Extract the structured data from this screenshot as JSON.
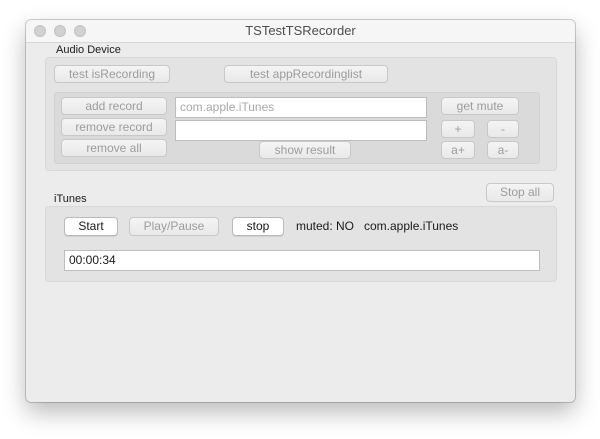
{
  "window": {
    "title": "TSTestTSRecorder"
  },
  "audio_device": {
    "label": "Audio Device",
    "test_is_recording": "test isRecording",
    "test_app_recording_list": "test appRecordinglist",
    "add_record": "add record",
    "remove_record": "remove record",
    "remove_all": "remove all",
    "bundle_field_value": "com.apple.iTunes",
    "result_field_value": "",
    "show_result": "show result",
    "get_mute": "get mute",
    "plus": "+",
    "minus": "-",
    "a_plus": "a+",
    "a_minus": "a-"
  },
  "stop_all": "Stop all",
  "itunes": {
    "label": "iTunes",
    "start": "Start",
    "play_pause": "Play/Pause",
    "stop": "stop",
    "muted_status": "muted: NO",
    "app_id": "com.apple.iTunes",
    "time_value": "00:00:34"
  }
}
